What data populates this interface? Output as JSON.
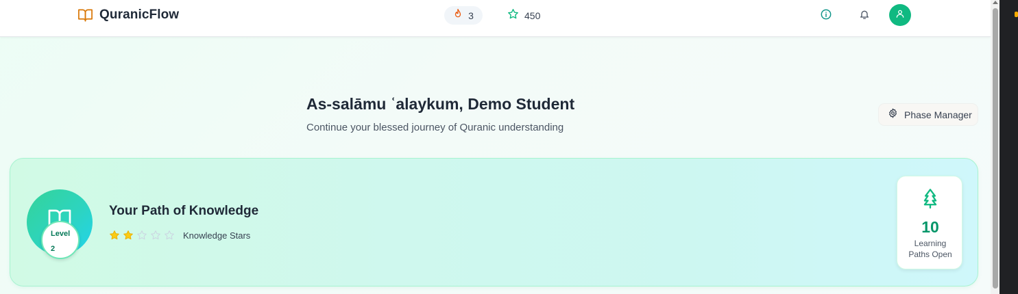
{
  "header": {
    "brand_name": "QuranicFlow",
    "brand_icon": "book-open-icon",
    "streak_count": "3",
    "streak_icon": "flame-icon",
    "stars_count": "450",
    "stars_icon": "star-icon",
    "info_icon": "info-icon",
    "bell_icon": "bell-icon",
    "avatar_icon": "user-icon"
  },
  "greeting": {
    "title": "As-salāmu ʿalaykum, Demo Student",
    "subtitle": "Continue your blessed journey of Quranic understanding"
  },
  "phase_manager": {
    "label": "Phase Manager",
    "icon": "gear-icon"
  },
  "path_card": {
    "title": "Your Path of Knowledge",
    "level_label": "Level",
    "level_value": "2",
    "stars_filled": 2,
    "stars_total": 5,
    "stars_label": "Knowledge Stars",
    "paths_count": "10",
    "paths_caption_line1": "Learning",
    "paths_caption_line2": "Paths Open",
    "paths_icon": "tree-icon"
  },
  "colors": {
    "accent": "#10b981",
    "brand_icon": "#d97706",
    "flame": "#ea580c",
    "star_filled": "#facc15",
    "count_text": "#059669"
  }
}
